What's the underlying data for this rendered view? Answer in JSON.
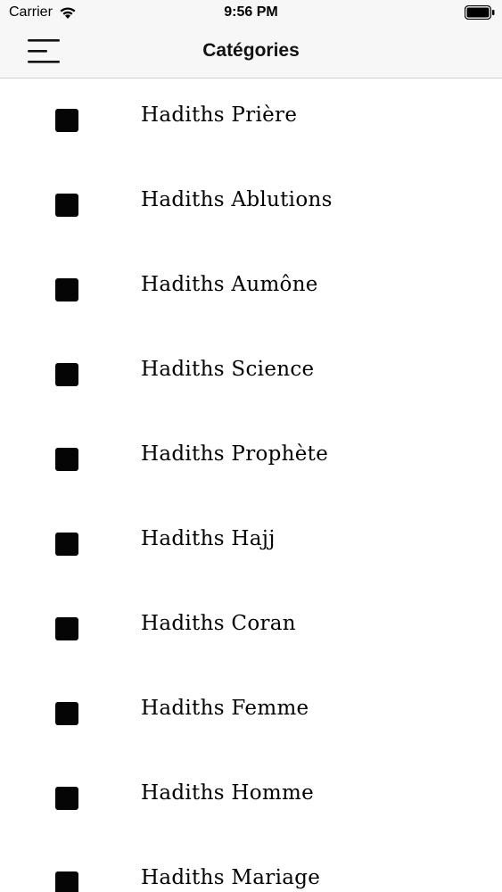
{
  "status_bar": {
    "carrier": "Carrier",
    "time": "9:56 PM",
    "wifi_icon": "wifi-icon",
    "battery_icon": "battery-icon"
  },
  "nav_bar": {
    "menu_icon": "menu-icon",
    "title": "Catégories"
  },
  "categories": [
    {
      "label": "Hadiths Prière",
      "icon": "square-icon"
    },
    {
      "label": "Hadiths Ablutions",
      "icon": "square-icon"
    },
    {
      "label": "Hadiths Aumône",
      "icon": "square-icon"
    },
    {
      "label": "Hadiths Science",
      "icon": "square-icon"
    },
    {
      "label": "Hadiths Prophète",
      "icon": "square-icon"
    },
    {
      "label": "Hadiths Hajj",
      "icon": "square-icon"
    },
    {
      "label": "Hadiths Coran",
      "icon": "square-icon"
    },
    {
      "label": "Hadiths Femme",
      "icon": "square-icon"
    },
    {
      "label": "Hadiths Homme",
      "icon": "square-icon"
    },
    {
      "label": "Hadiths Mariage",
      "icon": "square-icon"
    }
  ],
  "colors": {
    "bar_background": "#f7f7f7",
    "icon_fill": "#050505",
    "text": "#000000"
  }
}
